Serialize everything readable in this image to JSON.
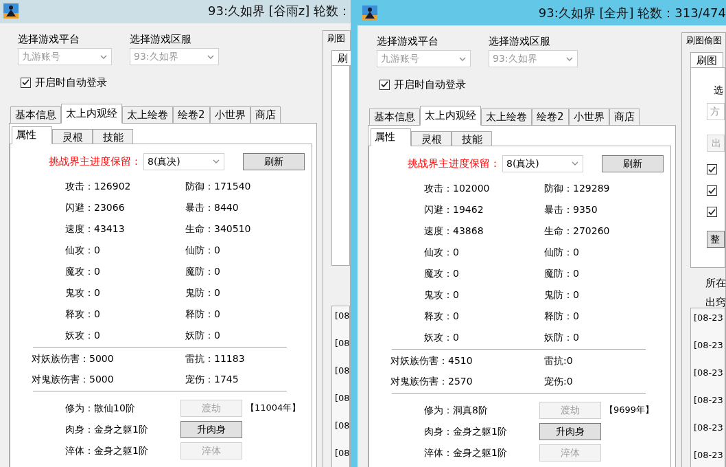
{
  "windows": [
    {
      "title": "93:久如界 [谷雨z] 轮数：",
      "active": false,
      "platform": {
        "label": "选择游戏平台",
        "value": "九游账号"
      },
      "server": {
        "label": "选择游戏区服",
        "value": "93:久如界"
      },
      "auto_login": {
        "label": "开启时自动登录",
        "checked": true
      },
      "tabs": [
        {
          "label": "基本信息",
          "selected": false
        },
        {
          "label": "太上内观经",
          "selected": true
        },
        {
          "label": "太上绘卷",
          "selected": false
        },
        {
          "label": "绘卷2",
          "selected": false
        },
        {
          "label": "小世界",
          "selected": false
        },
        {
          "label": "商店",
          "selected": false
        }
      ],
      "sub_tabs": [
        {
          "label": "属性",
          "selected": true
        },
        {
          "label": "灵根",
          "selected": false
        },
        {
          "label": "技能",
          "selected": false
        }
      ],
      "challenge": {
        "label": "挑战界主进度保留：",
        "value": "8(真决)",
        "button": "刷新"
      },
      "stat_rows": [
        {
          "column_1": "攻击：126902",
          "column_2": "防御：171540"
        },
        {
          "column_1": "闪避：23066",
          "column_2": "暴击：8440"
        },
        {
          "column_1": "速度：43413",
          "column_2": "生命：340510"
        },
        {
          "column_1": "仙攻：0",
          "column_2": "仙防：0"
        },
        {
          "column_1": "魔攻：0",
          "column_2": "魔防：0"
        },
        {
          "column_1": "鬼攻：0",
          "column_2": "鬼防：0"
        },
        {
          "column_1": "释攻：0",
          "column_2": "释防：0"
        },
        {
          "column_1": "妖攻：0",
          "column_2": "妖防：0"
        }
      ],
      "damage_rows": [
        {
          "column_1": "对妖族伤害：5000",
          "column_2": "雷抗：11183"
        },
        {
          "column_1": "对鬼族伤害：5000",
          "column_2": "宠伤：1745"
        }
      ],
      "cultivation_rows": [
        {
          "label": "修为：散仙10阶",
          "button": "渡劫",
          "disabled": true,
          "note": "【11004年】"
        },
        {
          "label": "肉身：金身之躯1阶",
          "button": "升肉身",
          "disabled": false
        },
        {
          "label": "淬体：金身之躯1阶",
          "button": "淬体",
          "disabled": true
        }
      ],
      "side_group": {
        "title": "刷图",
        "tabs": [
          {
            "label": "刷",
            "selected": true
          }
        ],
        "log": [
          "[08",
          "[08",
          "[08",
          "[08",
          "[08",
          "[08"
        ]
      }
    },
    {
      "title": "93:久如界 [全舟] 轮数：313/474",
      "active": true,
      "platform": {
        "label": "选择游戏平台",
        "value": "九游账号"
      },
      "server": {
        "label": "选择游戏区服",
        "value": "93:久如界"
      },
      "auto_login": {
        "label": "开启时自动登录",
        "checked": true
      },
      "tabs": [
        {
          "label": "基本信息",
          "selected": false
        },
        {
          "label": "太上内观经",
          "selected": true
        },
        {
          "label": "太上绘卷",
          "selected": false
        },
        {
          "label": "绘卷2",
          "selected": false
        },
        {
          "label": "小世界",
          "selected": false
        },
        {
          "label": "商店",
          "selected": false
        }
      ],
      "sub_tabs": [
        {
          "label": "属性",
          "selected": true
        },
        {
          "label": "灵根",
          "selected": false
        },
        {
          "label": "技能",
          "selected": false
        }
      ],
      "challenge": {
        "label": "挑战界主进度保留：",
        "value": "8(真决)",
        "button": "刷新"
      },
      "stat_rows": [
        {
          "column_1": "攻击：102000",
          "column_2": "防御：129289"
        },
        {
          "column_1": "闪避：19462",
          "column_2": "暴击：9350"
        },
        {
          "column_1": "速度：43868",
          "column_2": "生命：270260"
        },
        {
          "column_1": "仙攻：0",
          "column_2": "仙防：0"
        },
        {
          "column_1": "魔攻：0",
          "column_2": "魔防：0"
        },
        {
          "column_1": "鬼攻：0",
          "column_2": "鬼防：0"
        },
        {
          "column_1": "释攻：0",
          "column_2": "释防：0"
        },
        {
          "column_1": "妖攻：0",
          "column_2": "妖防：0"
        }
      ],
      "damage_rows": [
        {
          "column_1": "对妖族伤害：4510",
          "column_2": "雷抗:0"
        },
        {
          "column_1": "对鬼族伤害：2570",
          "column_2": "宠伤:0"
        }
      ],
      "cultivation_rows": [
        {
          "label": "修为：洞真8阶",
          "button": "渡劫",
          "disabled": true,
          "note": "【9699年】"
        },
        {
          "label": "肉身：金身之躯1阶",
          "button": "升肉身",
          "disabled": false
        },
        {
          "label": "淬体：金身之躯1阶",
          "button": "淬体",
          "disabled": true
        }
      ],
      "side_group": {
        "title": "刷图偷图",
        "tabs": [
          {
            "label": "刷图",
            "selected": true
          }
        ],
        "panel_label": "选",
        "scheme_value": "方",
        "button_1": "出",
        "checkboxes": [
          {
            "checked": true
          },
          {
            "checked": true
          },
          {
            "checked": true
          }
        ],
        "button_2": "整",
        "labels": [
          "所在",
          "出窍"
        ],
        "log": [
          "[08-23",
          "[08-23",
          "[08-23",
          "[08-23",
          "[08-23",
          "[08-23"
        ]
      }
    }
  ]
}
